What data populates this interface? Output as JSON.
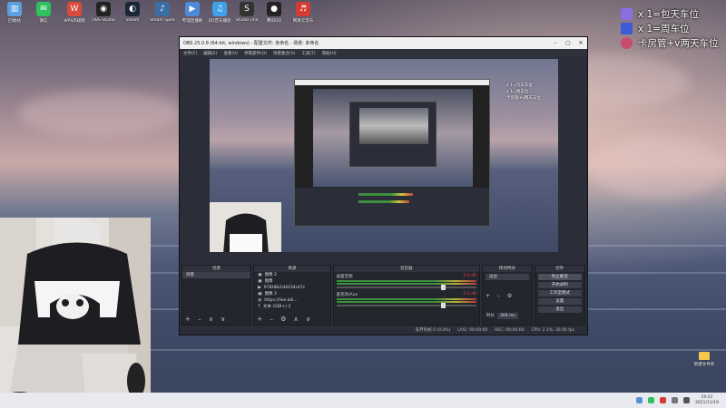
{
  "desktop_icons": [
    {
      "label": "回收站",
      "color": "#5aa0e0",
      "glyph": "▥",
      "icon": "recycle-bin-icon"
    },
    {
      "label": "微信",
      "color": "#2ec15e",
      "glyph": "✉",
      "icon": "wechat-icon"
    },
    {
      "label": "WPS高级版",
      "color": "#d94b3c",
      "glyph": "W",
      "icon": "wps-icon"
    },
    {
      "label": "OBS Studio",
      "color": "#222222",
      "glyph": "◉",
      "icon": "obs-icon"
    },
    {
      "label": "Steam",
      "color": "#1b2838",
      "glyph": "◐",
      "icon": "steam-icon"
    },
    {
      "label": "Steam Spea",
      "color": "#3a6ea5",
      "glyph": "♪",
      "icon": "speaker-app-icon"
    },
    {
      "label": "哔哩直播姬",
      "color": "#4d8bd8",
      "glyph": "▶",
      "icon": "bili-live-icon"
    },
    {
      "label": "QQ音乐播放",
      "color": "#3fa1e8",
      "glyph": "♫",
      "icon": "qq-music-icon"
    },
    {
      "label": "Studio One",
      "color": "#333333",
      "glyph": "S",
      "icon": "studio-one-icon"
    },
    {
      "label": "腾讯QQ",
      "color": "#222222",
      "glyph": "●",
      "icon": "qq-icon"
    },
    {
      "label": "网易云音乐",
      "color": "#d43c33",
      "glyph": "♬",
      "icon": "netease-music-icon"
    }
  ],
  "overlay": {
    "line1": "x 1=包天车位",
    "line2": "x 1=周车位",
    "line3": "卡房管+v两天车位",
    "colors": {
      "badge1": "#8a6fe0",
      "badge2": "#3b5bd9",
      "badge3": "#c94a6e"
    }
  },
  "obs": {
    "title": "OBS 25.0.8 (64-bit, windows) - 配置文件: 未命名 - 场景: 未命名",
    "menu": [
      "文件(F)",
      "编辑(E)",
      "查看(V)",
      "停靠部件(D)",
      "场景集合(S)",
      "工具(T)",
      "帮助(H)"
    ],
    "preview_overlay": [
      "x 1=包天车位",
      "x 1=周车位",
      "卡房管+v两天车位"
    ],
    "panels": {
      "scenes": {
        "header": "场景",
        "items": [
          "场景"
        ]
      },
      "sources": {
        "header": "来源",
        "items": [
          "图像 2",
          "图像",
          "97BHBs1d4234c47c",
          "图像 3",
          "https://live.bili...",
          "文本 (GDI+) 2"
        ]
      },
      "mixer": {
        "header": "混音器",
        "channels": [
          {
            "name": "桌面音频",
            "db": "0.0 dB"
          },
          {
            "name": "麦克风/Aux",
            "db": "-3.3 dB"
          }
        ]
      },
      "transitions": {
        "header": "转场特效",
        "type": "淡出",
        "duration_label": "时长",
        "duration": "300 ms"
      },
      "controls": {
        "header": "控件",
        "buttons": [
          "停止推流",
          "开始录制",
          "工作室模式",
          "设置",
          "退出"
        ]
      }
    },
    "status": {
      "drop": "丢弃的帧 0 (0.0%)",
      "live": "LIVE: 00:00:00",
      "rec": "REC: 00:00:00",
      "cpu": "CPU: 2.1%, 30.00 fps"
    }
  },
  "folder": {
    "label": "新建文件夹"
  },
  "taskbar": {
    "time": "19:21",
    "date": "2021/11/19"
  }
}
